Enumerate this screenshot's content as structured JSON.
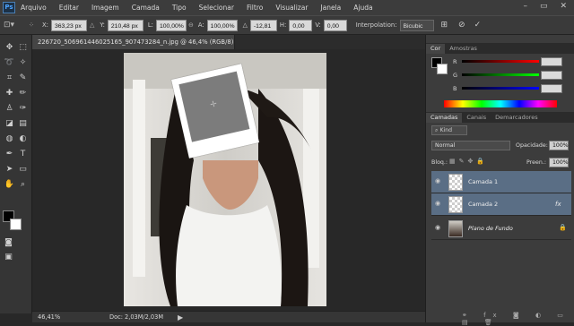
{
  "app": {
    "logo": "Ps"
  },
  "menu": [
    "Arquivo",
    "Editar",
    "Imagem",
    "Camada",
    "Tipo",
    "Selecionar",
    "Filtro",
    "Visualizar",
    "Janela",
    "Ajuda"
  ],
  "window_controls": {
    "minimize": "–",
    "restore": "▭",
    "close": "✕"
  },
  "options_bar": {
    "x_label": "X:",
    "x_value": "363,23 px",
    "y_label": "Y:",
    "y_value": "210,48 px",
    "w_label": "L:",
    "w_value": "100,00%",
    "h_label": "A:",
    "h_value": "100,00%",
    "angle_label": "△",
    "angle_value": "-12,81",
    "hskew_label": "H:",
    "hskew_value": "0,00",
    "vskew_label": "V:",
    "vskew_value": "0,00",
    "interp_label": "Interpolation:",
    "interp_value": "Bicubic"
  },
  "document": {
    "tab_title": "226720_506961446025165_907473284_n.jpg @ 46,4% (RGB/8) *",
    "tab_close": "×"
  },
  "status": {
    "zoom": "46,41%",
    "doc_info": "Doc: 2,03M/2,03M"
  },
  "color_panel": {
    "tabs": [
      "Cor",
      "Amostras"
    ],
    "channels": [
      {
        "label": "R",
        "value": ""
      },
      {
        "label": "G",
        "value": ""
      },
      {
        "label": "B",
        "value": ""
      }
    ]
  },
  "layers_panel": {
    "tabs": [
      "Camadas",
      "Canais",
      "Demarcadores"
    ],
    "kind_label": "Kind",
    "blend_mode": "Normal",
    "opacity_label": "Opacidade:",
    "opacity_value": "100%",
    "lock_label": "Bloq.:",
    "fill_label": "Preen.:",
    "fill_value": "100%",
    "layers": [
      {
        "name": "Camada 1",
        "selected": true
      },
      {
        "name": "Camada 2",
        "selected": true,
        "fx": "fx"
      },
      {
        "name": "Plano de Fundo",
        "selected": false
      }
    ]
  },
  "colors": {
    "accent_selection": "#5a6e85",
    "foreground": "#000000",
    "background": "#ffffff"
  }
}
